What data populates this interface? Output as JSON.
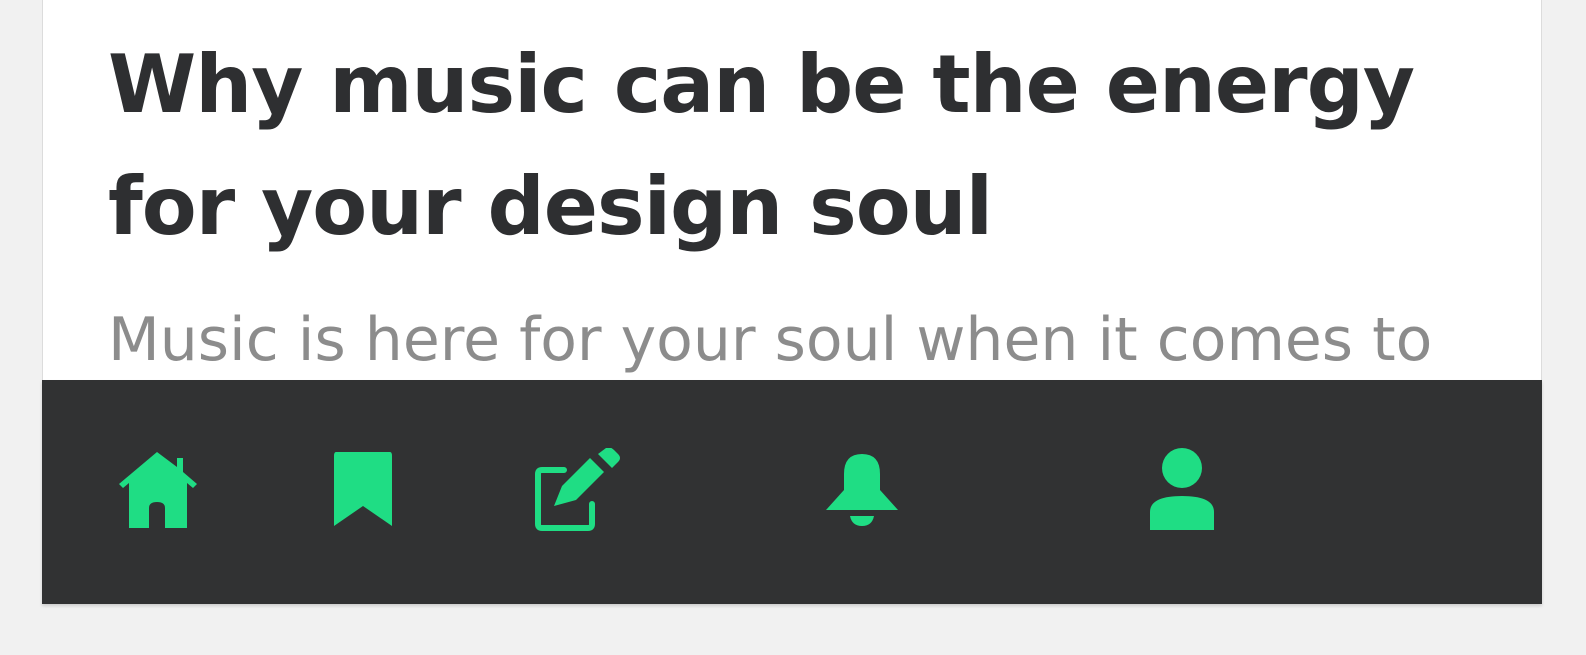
{
  "article": {
    "title": "Why music can be the energy for your design soul",
    "excerpt": "Music is here for your soul when it comes to"
  },
  "bottom_nav": {
    "accent_color": "#1fdd84",
    "background_color": "#313233",
    "items": [
      {
        "id": "home",
        "icon": "home-icon"
      },
      {
        "id": "bookmarks",
        "icon": "bookmark-icon"
      },
      {
        "id": "write",
        "icon": "edit-icon"
      },
      {
        "id": "notifications",
        "icon": "bell-icon"
      },
      {
        "id": "profile",
        "icon": "user-icon"
      }
    ]
  }
}
